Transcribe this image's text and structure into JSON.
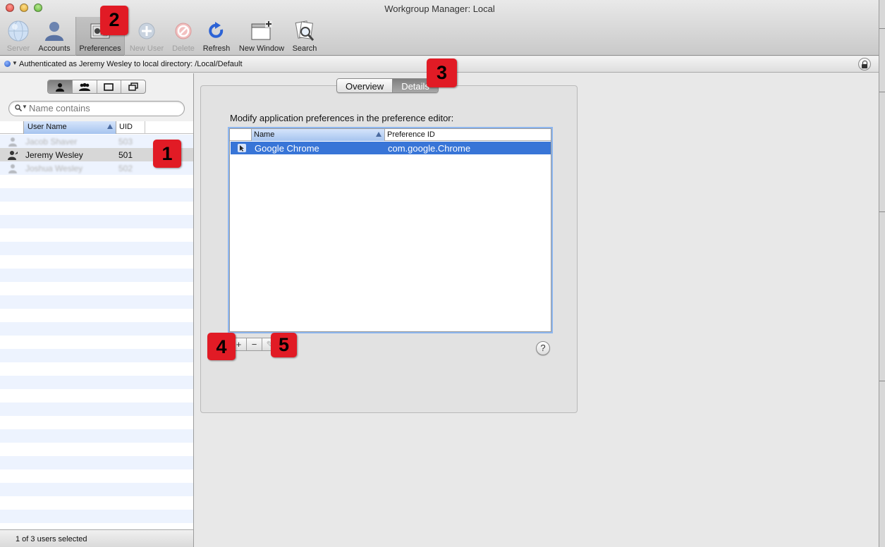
{
  "window": {
    "title": "Workgroup Manager: Local"
  },
  "toolbar": {
    "items": [
      {
        "label": "Server",
        "icon": "globe-icon",
        "state": "disabled"
      },
      {
        "label": "Accounts",
        "icon": "user-icon",
        "state": "normal"
      },
      {
        "label": "Preferences",
        "icon": "preferences-icon",
        "state": "selected"
      },
      {
        "label": "New User",
        "icon": "add-icon",
        "state": "disabled"
      },
      {
        "label": "Delete",
        "icon": "delete-icon",
        "state": "disabled"
      },
      {
        "label": "Refresh",
        "icon": "refresh-icon",
        "state": "normal"
      },
      {
        "label": "New Window",
        "icon": "new-window-icon",
        "state": "normal"
      },
      {
        "label": "Search",
        "icon": "search-icon",
        "state": "normal"
      }
    ]
  },
  "auth": {
    "text": "Authenticated as Jeremy Wesley to local directory: /Local/Default",
    "lock_icon": "lock-icon"
  },
  "sidebar": {
    "segments": [
      "user-icon",
      "group-icon",
      "computer-icon",
      "computer-group-icon"
    ],
    "search": {
      "placeholder": "Name contains",
      "value": ""
    },
    "columns": {
      "name": "User Name",
      "uid": "UID"
    },
    "users": [
      {
        "name": "Jacob Shaver",
        "uid": "503",
        "blurred": true
      },
      {
        "name": "Jeremy Wesley",
        "uid": "501",
        "selected": true
      },
      {
        "name": "Joshua Wesley",
        "uid": "502",
        "blurred": true
      }
    ],
    "footer": "1 of 3 users selected"
  },
  "main": {
    "tabs": [
      {
        "label": "Overview",
        "active": false
      },
      {
        "label": "Details",
        "active": true
      }
    ],
    "instructions": "Modify application preferences in the preference editor:",
    "table": {
      "columns": {
        "name": "Name",
        "id": "Preference ID"
      },
      "rows": [
        {
          "name": "Google Chrome",
          "id": "com.google.Chrome",
          "selected": true
        }
      ]
    },
    "buttons": {
      "add": "+",
      "remove": "−",
      "edit": "✎"
    },
    "help": "?"
  },
  "callouts": [
    "1",
    "2",
    "3",
    "4",
    "5"
  ],
  "colors": {
    "selection": "#3875d7",
    "callout": "#e11b25",
    "header_sort": "#a6c4ef"
  }
}
